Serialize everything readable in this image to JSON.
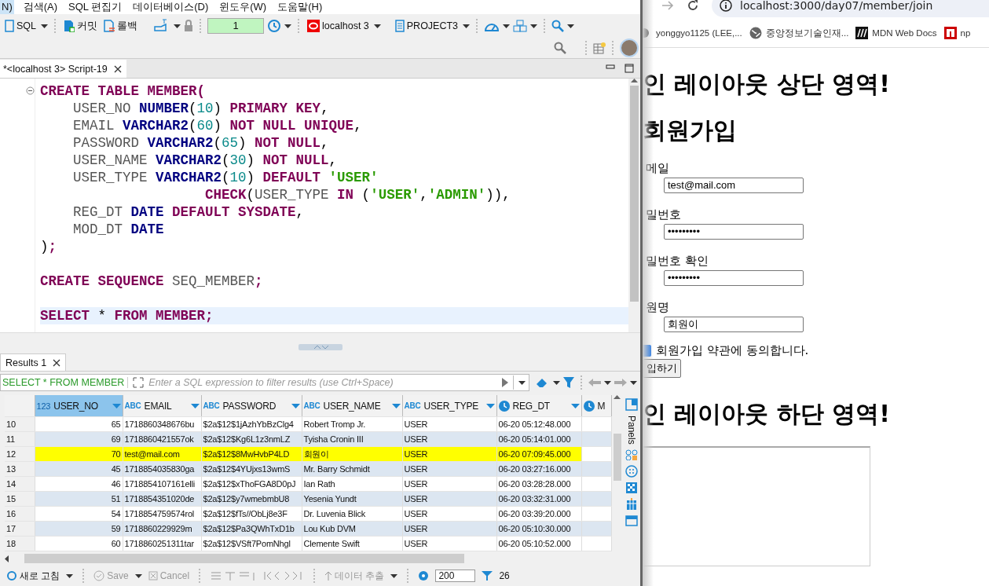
{
  "menu_bar": [
    {
      "label": "N)",
      "selected": true
    },
    {
      "label": "검색(A)",
      "selected": false
    },
    {
      "label": "SQL 편집기",
      "selected": false
    },
    {
      "label": "데이터베이스(D)",
      "selected": false
    },
    {
      "label": "윈도우(W)",
      "selected": false
    },
    {
      "label": "도움말(H)",
      "selected": false
    }
  ],
  "toolbar": {
    "sql": "SQL",
    "commit": "커밋",
    "rollback": "롤백",
    "transaction_count": "1",
    "connection": "localhost 3",
    "project": "PROJECT3"
  },
  "editor": {
    "tab": {
      "title": "*<localhost 3> Script-19",
      "selected": true
    },
    "lines": [
      {
        "kind": "code",
        "current": false,
        "tokens": [
          {
            "kind": "keyword",
            "text": "CREATE TABLE MEMBER("
          }
        ]
      },
      {
        "kind": "code",
        "current": false,
        "tokens": [
          {
            "kind": "ident",
            "text": "    USER_NO "
          },
          {
            "kind": "type",
            "text": "NUMBER"
          },
          {
            "kind": "plain",
            "text": "("
          },
          {
            "kind": "number",
            "text": "10"
          },
          {
            "kind": "plain",
            "text": ") "
          },
          {
            "kind": "keyword",
            "text": "PRIMARY KEY"
          },
          {
            "kind": "plain",
            "text": ","
          }
        ]
      },
      {
        "kind": "code",
        "current": false,
        "tokens": [
          {
            "kind": "ident",
            "text": "    EMAIL "
          },
          {
            "kind": "type",
            "text": "VARCHAR2"
          },
          {
            "kind": "plain",
            "text": "("
          },
          {
            "kind": "number",
            "text": "60"
          },
          {
            "kind": "plain",
            "text": ") "
          },
          {
            "kind": "keyword",
            "text": "NOT NULL UNIQUE"
          },
          {
            "kind": "plain",
            "text": ","
          }
        ]
      },
      {
        "kind": "code",
        "current": false,
        "tokens": [
          {
            "kind": "ident",
            "text": "    PASSWORD "
          },
          {
            "kind": "type",
            "text": "VARCHAR2"
          },
          {
            "kind": "plain",
            "text": "("
          },
          {
            "kind": "number",
            "text": "65"
          },
          {
            "kind": "plain",
            "text": ") "
          },
          {
            "kind": "keyword",
            "text": "NOT NULL"
          },
          {
            "kind": "plain",
            "text": ","
          }
        ]
      },
      {
        "kind": "code",
        "current": false,
        "tokens": [
          {
            "kind": "ident",
            "text": "    USER_NAME "
          },
          {
            "kind": "type",
            "text": "VARCHAR2"
          },
          {
            "kind": "plain",
            "text": "("
          },
          {
            "kind": "number",
            "text": "30"
          },
          {
            "kind": "plain",
            "text": ") "
          },
          {
            "kind": "keyword",
            "text": "NOT NULL"
          },
          {
            "kind": "plain",
            "text": ","
          }
        ]
      },
      {
        "kind": "code",
        "current": false,
        "tokens": [
          {
            "kind": "ident",
            "text": "    USER_TYPE "
          },
          {
            "kind": "type",
            "text": "VARCHAR2"
          },
          {
            "kind": "plain",
            "text": "("
          },
          {
            "kind": "number",
            "text": "10"
          },
          {
            "kind": "plain",
            "text": ") "
          },
          {
            "kind": "keyword",
            "text": "DEFAULT "
          },
          {
            "kind": "string",
            "text": "'USER'"
          }
        ]
      },
      {
        "kind": "code",
        "current": false,
        "tokens": [
          {
            "kind": "keyword",
            "text": "                    CHECK"
          },
          {
            "kind": "plain",
            "text": "("
          },
          {
            "kind": "ident",
            "text": "USER_TYPE "
          },
          {
            "kind": "keyword",
            "text": "IN"
          },
          {
            "kind": "plain",
            "text": " ("
          },
          {
            "kind": "string",
            "text": "'USER'"
          },
          {
            "kind": "plain",
            "text": ","
          },
          {
            "kind": "string",
            "text": "'ADMIN'"
          },
          {
            "kind": "plain",
            "text": ")),"
          }
        ]
      },
      {
        "kind": "code",
        "current": false,
        "tokens": [
          {
            "kind": "ident",
            "text": "    REG_DT "
          },
          {
            "kind": "type",
            "text": "DATE "
          },
          {
            "kind": "keyword",
            "text": "DEFAULT SYSDATE"
          },
          {
            "kind": "plain",
            "text": ","
          }
        ]
      },
      {
        "kind": "code",
        "current": false,
        "tokens": [
          {
            "kind": "ident",
            "text": "    MOD_DT "
          },
          {
            "kind": "type",
            "text": "DATE"
          }
        ]
      },
      {
        "kind": "code",
        "current": false,
        "tokens": [
          {
            "kind": "plain",
            "text": ")"
          },
          {
            "kind": "keyword",
            "text": ";"
          }
        ]
      },
      {
        "kind": "blank",
        "current": false
      },
      {
        "kind": "code",
        "current": false,
        "tokens": [
          {
            "kind": "keyword",
            "text": "CREATE SEQUENCE "
          },
          {
            "kind": "ident",
            "text": "SEQ_MEMBER"
          },
          {
            "kind": "keyword",
            "text": ";"
          }
        ]
      },
      {
        "kind": "blank",
        "current": false
      },
      {
        "kind": "code",
        "current": true,
        "tokens": [
          {
            "kind": "keyword",
            "text": "SELECT"
          },
          {
            "kind": "plain",
            "text": " * "
          },
          {
            "kind": "keyword",
            "text": "FROM MEMBER;"
          }
        ]
      },
      {
        "kind": "blank",
        "current": false
      }
    ]
  },
  "results": {
    "tab": {
      "title": "Results 1",
      "selected": true
    },
    "query": "SELECT * FROM MEMBER",
    "filter_placeholder": "Enter a SQL expression to filter results (use Ctrl+Space)",
    "columns": [
      {
        "kind": "number",
        "type_label": "123",
        "label": "USER_NO",
        "selected": true
      },
      {
        "kind": "text",
        "type_label": "ABC",
        "label": "EMAIL",
        "selected": false
      },
      {
        "kind": "text",
        "type_label": "ABC",
        "label": "PASSWORD",
        "selected": false
      },
      {
        "kind": "text",
        "type_label": "ABC",
        "label": "USER_NAME",
        "selected": false
      },
      {
        "kind": "text",
        "type_label": "ABC",
        "label": "USER_TYPE",
        "selected": false
      },
      {
        "kind": "date",
        "label": "REG_DT",
        "selected": false
      },
      {
        "kind": "date",
        "label": "M",
        "selected": false
      }
    ],
    "rows": [
      {
        "row_number": "10",
        "highlighted": false,
        "cells": [
          "65",
          "1718860348676bu",
          "$2a$12$1jAzhYbBzClg4",
          "Robert Tromp Jr.",
          "USER",
          "06-20 05:12:48.000"
        ]
      },
      {
        "row_number": "11",
        "highlighted": false,
        "cells": [
          "69",
          "1718860421557ok",
          "$2a$12$Kg6L1z3nmLZ",
          "Tyisha Cronin III",
          "USER",
          "06-20 05:14:01.000"
        ]
      },
      {
        "row_number": "12",
        "highlighted": true,
        "cells": [
          "70",
          "test@mail.com",
          "$2a$12$8MwHvbP4LD",
          "회원이",
          "USER",
          "06-20 07:09:45.000"
        ]
      },
      {
        "row_number": "13",
        "highlighted": false,
        "cells": [
          "45",
          "1718854035830ga",
          "$2a$12$4YUjxs13wmS",
          "Mr. Barry Schmidt",
          "USER",
          "06-20 03:27:16.000"
        ]
      },
      {
        "row_number": "14",
        "highlighted": false,
        "cells": [
          "46",
          "1718854107161elli",
          "$2a$12$xThoFGA8D0pJ",
          "Ian Rath",
          "USER",
          "06-20 03:28:28.000"
        ]
      },
      {
        "row_number": "15",
        "highlighted": false,
        "cells": [
          "51",
          "1718854351020de",
          "$2a$12$y7wmebmbU8",
          "Yesenia Yundt",
          "USER",
          "06-20 03:32:31.000"
        ]
      },
      {
        "row_number": "16",
        "highlighted": false,
        "cells": [
          "54",
          "1718854759574rol",
          "$2a$12$fTs//ObLj8e3F",
          "Dr. Luvenia Blick",
          "USER",
          "06-20 03:39:20.000"
        ]
      },
      {
        "row_number": "17",
        "highlighted": false,
        "cells": [
          "59",
          "1718860229929m",
          "$2a$12$Pa3QWhTxD1b",
          "Lou Kub DVM",
          "USER",
          "06-20 05:10:30.000"
        ]
      },
      {
        "row_number": "18",
        "highlighted": false,
        "cells": [
          "60",
          "1718860251311tar",
          "$2a$12$VSft7PomNhgl",
          "Clemente Swift",
          "USER",
          "06-20 05:10:52.000"
        ]
      }
    ],
    "side_panel": "Panels",
    "bottom_toolbar": {
      "refresh": "새로 고침",
      "save": "Save",
      "cancel": "Cancel",
      "export": "데이터 추출",
      "fetch_size": "200",
      "count": "26"
    }
  },
  "browser": {
    "url": "localhost:3000/day07/member/join",
    "bookmarks": [
      {
        "kind": "github",
        "label": "yonggyo1125 (LEE,..."
      },
      {
        "kind": "globe",
        "label": "중앙정보기술인재..."
      },
      {
        "kind": "mdn",
        "label": "MDN Web Docs"
      },
      {
        "kind": "npm",
        "label": "np"
      }
    ],
    "page": {
      "header": "인 레이아웃 상단 영역!",
      "title": "회원가입",
      "fields": [
        {
          "label": "메일",
          "value": "test@mail.com"
        },
        {
          "label": "밀번호",
          "value": "•••••••••"
        },
        {
          "label": "밀번호 확인",
          "value": "•••••••••"
        },
        {
          "label": "원명",
          "value": "회원이"
        }
      ],
      "agree": {
        "label": "회원가입 약관에 동의합니다.",
        "checked": true
      },
      "submit": "입하기",
      "footer": "인 레이아웃 하단 영역!"
    }
  }
}
